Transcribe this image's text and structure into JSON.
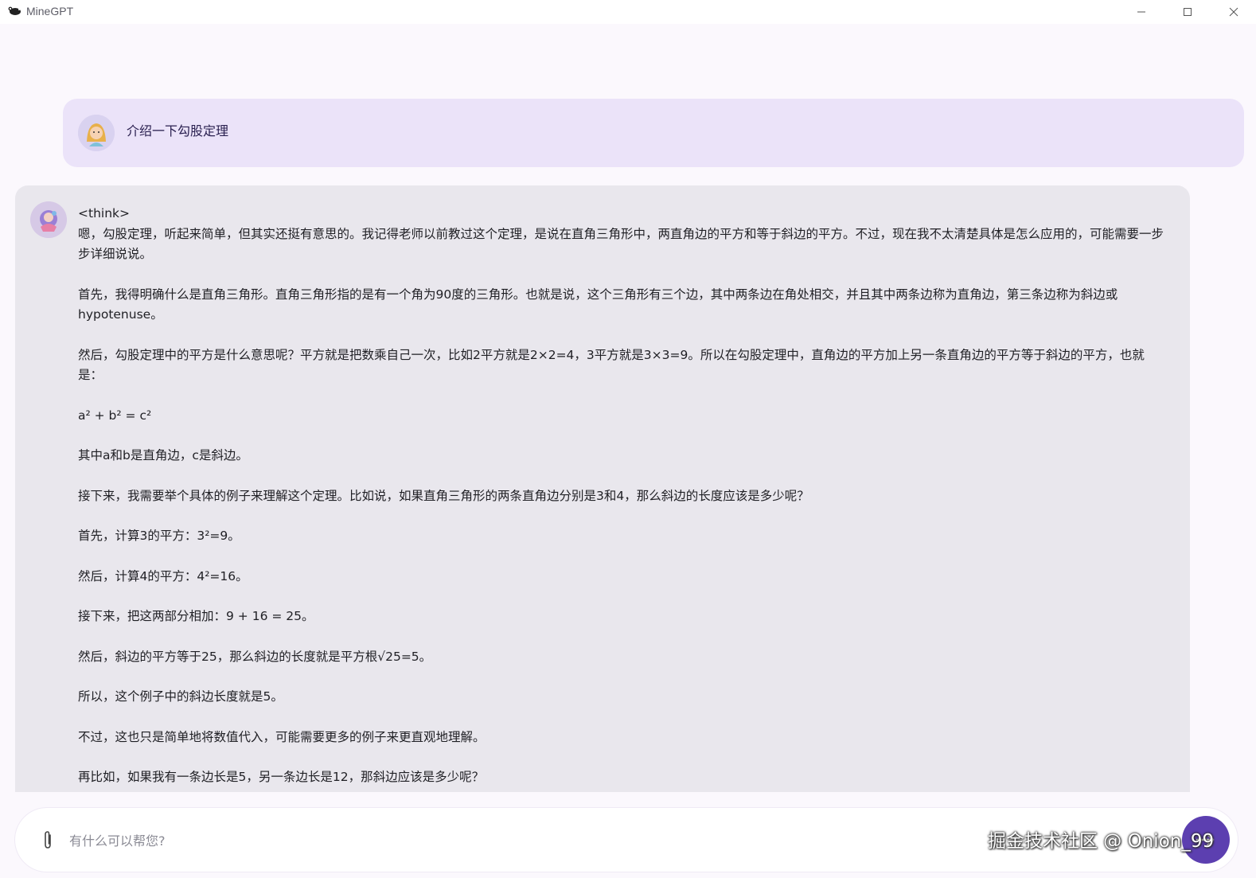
{
  "window": {
    "title": "MineGPT"
  },
  "user_message": {
    "text": "介绍一下勾股定理"
  },
  "assistant_message": {
    "paragraphs": [
      "<think>",
      "嗯，勾股定理，听起来简单，但其实还挺有意思的。我记得老师以前教过这个定理，是说在直角三角形中，两直角边的平方和等于斜边的平方。不过，现在我不太清楚具体是怎么应用的，可能需要一步步详细说说。",
      "首先，我得明确什么是直角三角形。直角三角形指的是有一个角为90度的三角形。也就是说，这个三角形有三个边，其中两条边在角处相交，并且其中两条边称为直角边，第三条边称为斜边或hypotenuse。",
      "然后，勾股定理中的平方是什么意思呢？平方就是把数乘自己一次，比如2平方就是2×2=4，3平方就是3×3=9。所以在勾股定理中，直角边的平方加上另一条直角边的平方等于斜边的平方，也就是：",
      "a² + b² = c²",
      "其中a和b是直角边，c是斜边。",
      "接下来，我需要举个具体的例子来理解这个定理。比如说，如果直角三角形的两条直角边分别是3和4，那么斜边的长度应该是多少呢？",
      "首先，计算3的平方：3²=9。",
      "然后，计算4的平方：4²=16。",
      "接下来，把这两部分相加：9 + 16 = 25。",
      "然后，斜边的平方等于25，那么斜边的长度就是平方根√25=5。",
      "所以，这个例子中的斜边长度就是5。",
      "不过，这也只是简单地将数值代入，可能需要更多的例子来更直观地理解。",
      "再比如，如果我有一条边长是5，另一条边长是12，那斜边应该是多少呢？"
    ]
  },
  "composer": {
    "placeholder": "有什么可以帮您?"
  },
  "watermark": {
    "text": "掘金技术社区 @ Onion_99"
  },
  "icons": {
    "app": "mouse-app-icon",
    "attach": "paperclip-icon",
    "send": "send-arrow-icon"
  },
  "colors": {
    "accent": "#5c3fb0",
    "user_bubble": "#ebe3f9",
    "assistant_bubble": "#e9e7ed"
  }
}
